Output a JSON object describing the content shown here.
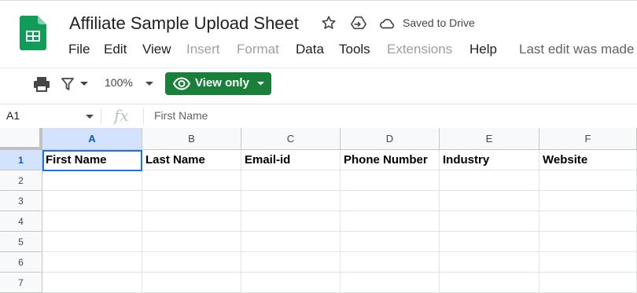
{
  "app": {
    "doc_title": "Affiliate Sample Upload Sheet",
    "saved_status": "Saved to Drive",
    "last_edit": "Last edit was made"
  },
  "menu": [
    {
      "label": "File",
      "enabled": true
    },
    {
      "label": "Edit",
      "enabled": true
    },
    {
      "label": "View",
      "enabled": true
    },
    {
      "label": "Insert",
      "enabled": false
    },
    {
      "label": "Format",
      "enabled": false
    },
    {
      "label": "Data",
      "enabled": true
    },
    {
      "label": "Tools",
      "enabled": true
    },
    {
      "label": "Extensions",
      "enabled": false
    },
    {
      "label": "Help",
      "enabled": true
    }
  ],
  "toolbar": {
    "zoom": "100%",
    "view_only_label": "View only"
  },
  "formula_bar": {
    "cell_ref": "A1",
    "fx": "fx",
    "value": "First Name"
  },
  "grid": {
    "columns": [
      "A",
      "B",
      "C",
      "D",
      "E",
      "F"
    ],
    "rows": [
      "1",
      "2",
      "3",
      "4",
      "5",
      "6",
      "7"
    ],
    "header_row": [
      "First Name",
      "Last Name",
      "Email-id",
      "Phone Number",
      "Industry",
      "Website"
    ]
  },
  "colors": {
    "brand_green": "#188038",
    "sheets_icon_green": "#0F9D58",
    "selection_blue": "#1a73e8"
  },
  "icons": [
    "sheets-logo-icon",
    "star-icon",
    "move-to-drive-icon",
    "cloud-saved-icon",
    "print-icon",
    "filter-icon",
    "eye-icon",
    "dropdown-caret-icon"
  ]
}
